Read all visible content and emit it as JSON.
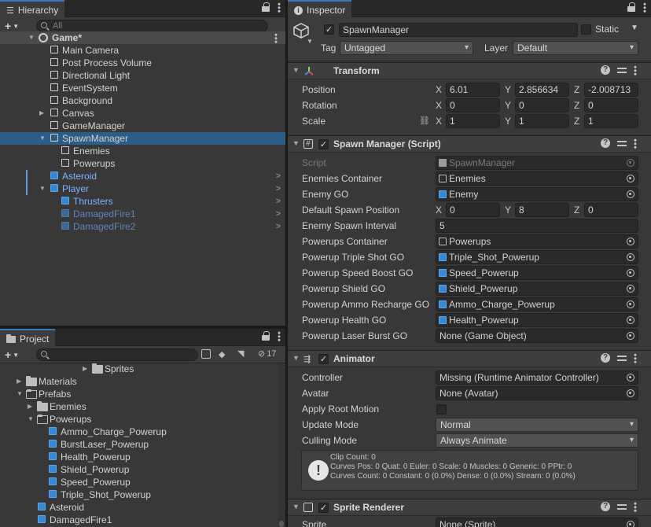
{
  "hierarchy": {
    "tab_label": "Hierarchy",
    "search_placeholder": "All",
    "scene": "Game*",
    "items": [
      {
        "label": "Main Camera"
      },
      {
        "label": "Post Process Volume"
      },
      {
        "label": "Directional Light"
      },
      {
        "label": "EventSystem"
      },
      {
        "label": "Background"
      },
      {
        "label": "Canvas"
      },
      {
        "label": "GameManager"
      },
      {
        "label": "SpawnManager"
      },
      {
        "label": "Enemies"
      },
      {
        "label": "Powerups"
      },
      {
        "label": "Asteroid"
      },
      {
        "label": "Player"
      },
      {
        "label": "Thrusters"
      },
      {
        "label": "DamagedFire1"
      },
      {
        "label": "DamagedFire2"
      }
    ]
  },
  "project": {
    "tab_label": "Project",
    "hidden_count": "17",
    "items": [
      {
        "label": "Sprites"
      },
      {
        "label": "Materials"
      },
      {
        "label": "Prefabs"
      },
      {
        "label": "Enemies"
      },
      {
        "label": "Powerups"
      },
      {
        "label": "Ammo_Charge_Powerup"
      },
      {
        "label": "BurstLaser_Powerup"
      },
      {
        "label": "Health_Powerup"
      },
      {
        "label": "Shield_Powerup"
      },
      {
        "label": "Speed_Powerup"
      },
      {
        "label": "Triple_Shot_Powerup"
      },
      {
        "label": "Asteroid"
      },
      {
        "label": "DamagedFire1"
      }
    ]
  },
  "inspector": {
    "tab_label": "Inspector",
    "object_name": "SpawnManager",
    "static_label": "Static",
    "tag_label": "Tag",
    "tag_value": "Untagged",
    "layer_label": "Layer",
    "layer_value": "Default",
    "transform": {
      "title": "Transform",
      "position_label": "Position",
      "rotation_label": "Rotation",
      "scale_label": "Scale",
      "position": {
        "x": "6.01",
        "y": "2.856634",
        "z": "-2.008713"
      },
      "rotation": {
        "x": "0",
        "y": "0",
        "z": "0"
      },
      "scale": {
        "x": "1",
        "y": "1",
        "z": "1"
      },
      "axis_x": "X",
      "axis_y": "Y",
      "axis_z": "Z"
    },
    "spawn_manager": {
      "title": "Spawn Manager (Script)",
      "script_label": "Script",
      "script_value": "SpawnManager",
      "enemies_container_label": "Enemies Container",
      "enemies_container_value": "Enemies",
      "enemy_go_label": "Enemy GO",
      "enemy_go_value": "Enemy",
      "default_spawn_label": "Default Spawn Position",
      "default_spawn": {
        "x": "0",
        "y": "8",
        "z": "0"
      },
      "enemy_interval_label": "Enemy Spawn Interval",
      "enemy_interval_value": "5",
      "powerups_container_label": "Powerups Container",
      "powerups_container_value": "Powerups",
      "triple_label": "Powerup Triple Shot GO",
      "triple_value": "Triple_Shot_Powerup",
      "speed_label": "Powerup Speed Boost GO",
      "speed_value": "Speed_Powerup",
      "shield_label": "Powerup Shield GO",
      "shield_value": "Shield_Powerup",
      "ammo_label": "Powerup Ammo Recharge GO",
      "ammo_value": "Ammo_Charge_Powerup",
      "health_label": "Powerup Health GO",
      "health_value": "Health_Powerup",
      "laser_label": "Powerup Laser Burst GO",
      "laser_value": "None (Game Object)"
    },
    "animator": {
      "title": "Animator",
      "controller_label": "Controller",
      "controller_value": "Missing (Runtime Animator Controller)",
      "avatar_label": "Avatar",
      "avatar_value": "None (Avatar)",
      "root_motion_label": "Apply Root Motion",
      "update_mode_label": "Update Mode",
      "update_mode_value": "Normal",
      "culling_mode_label": "Culling Mode",
      "culling_mode_value": "Always Animate",
      "info_line1": "Clip Count: 0",
      "info_line2": "Curves Pos: 0 Quat: 0 Euler: 0 Scale: 0 Muscles: 0 Generic: 0 PPtr: 0",
      "info_line3": "Curves Count: 0 Constant: 0 (0.0%) Dense: 0 (0.0%) Stream: 0 (0.0%)"
    },
    "sprite_renderer": {
      "title": "Sprite Renderer",
      "sprite_label": "Sprite",
      "sprite_value": "None (Sprite)"
    }
  }
}
